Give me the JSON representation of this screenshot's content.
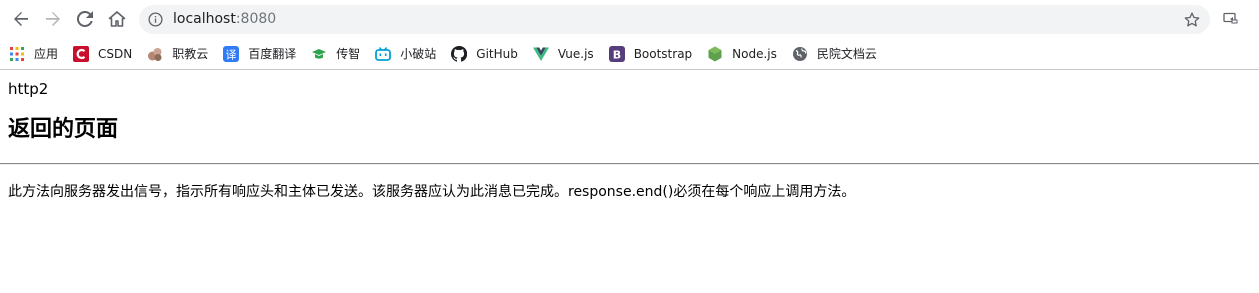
{
  "browser": {
    "url_host": "localhost",
    "url_port": ":8080",
    "nav": {
      "back": "back-arrow",
      "forward": "forward-arrow",
      "reload": "reload",
      "home": "home"
    }
  },
  "bookmarks": [
    {
      "label": "应用",
      "icon": "apps-grid-icon",
      "color": "#e53935"
    },
    {
      "label": "CSDN",
      "icon": "csdn-icon",
      "color": "#c8102e"
    },
    {
      "label": "职教云",
      "icon": "zhijiaoyun-icon",
      "color": "#b28b7a"
    },
    {
      "label": "百度翻译",
      "icon": "baidu-translate-icon",
      "color": "#2f7cf6"
    },
    {
      "label": "传智",
      "icon": "chuanzhi-icon",
      "color": "#2ea44f"
    },
    {
      "label": "小破站",
      "icon": "bilibili-icon",
      "color": "#00a1d6"
    },
    {
      "label": "GitHub",
      "icon": "github-icon",
      "color": "#1b1f23"
    },
    {
      "label": "Vue.js",
      "icon": "vue-icon",
      "color": "#41b883"
    },
    {
      "label": "Bootstrap",
      "icon": "bootstrap-icon",
      "color": "#563d7c"
    },
    {
      "label": "Node.js",
      "icon": "nodejs-icon",
      "color": "#5fa04e"
    },
    {
      "label": "民院文档云",
      "icon": "globe-icon",
      "color": "#5f6368"
    }
  ],
  "page": {
    "top_text": "http2",
    "heading": "返回的页面",
    "paragraph": "此方法向服务器发出信号，指示所有响应头和主体已发送。该服务器应认为此消息已完成。response.end()必须在每个响应上调用方法。"
  }
}
